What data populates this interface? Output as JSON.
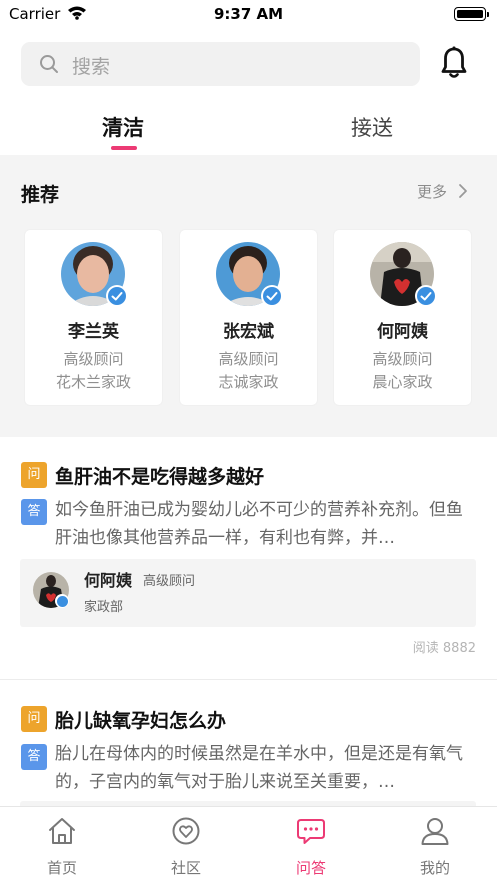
{
  "status_bar": {
    "carrier": "Carrier",
    "time": "9:37 AM"
  },
  "search": {
    "placeholder": "搜索"
  },
  "tabs": [
    {
      "label": "清洁",
      "active": true
    },
    {
      "label": "接送",
      "active": false
    }
  ],
  "recommend": {
    "title": "推荐",
    "more": "更多",
    "advisors": [
      {
        "name": "李兰英",
        "role": "高级顾问",
        "org": "花木兰家政"
      },
      {
        "name": "张宏斌",
        "role": "高级顾问",
        "org": "志诚家政"
      },
      {
        "name": "何阿姨",
        "role": "高级顾问",
        "org": "晨心家政"
      }
    ]
  },
  "qa": [
    {
      "q_badge": "问",
      "question": "鱼肝油不是吃得越多越好",
      "a_badge": "答",
      "answer": "如今鱼肝油已成为婴幼儿必不可少的营养补充剂。但鱼肝油也像其他营养品一样，有利也有弊，并…",
      "answerer": {
        "name": "何阿姨",
        "role": "高级顾问",
        "org": "家政部"
      },
      "reads": "阅读 8882"
    },
    {
      "q_badge": "问",
      "question": "胎儿缺氧孕妇怎么办",
      "a_badge": "答",
      "answer": "胎儿在母体内的时候虽然是在羊水中，但是还是有氧气的，子宫内的氧气对于胎儿来说至关重要，…"
    }
  ],
  "tabbar": [
    {
      "label": "首页",
      "icon": "home-icon",
      "active": false
    },
    {
      "label": "社区",
      "icon": "heart-circle-icon",
      "active": false
    },
    {
      "label": "问答",
      "icon": "chat-bubble-icon",
      "active": true
    },
    {
      "label": "我的",
      "icon": "user-icon",
      "active": false
    }
  ],
  "colors": {
    "accent": "#ec3a74",
    "question_badge": "#eda42c",
    "answer_badge": "#5a96ea",
    "verify": "#3a8fe0"
  }
}
